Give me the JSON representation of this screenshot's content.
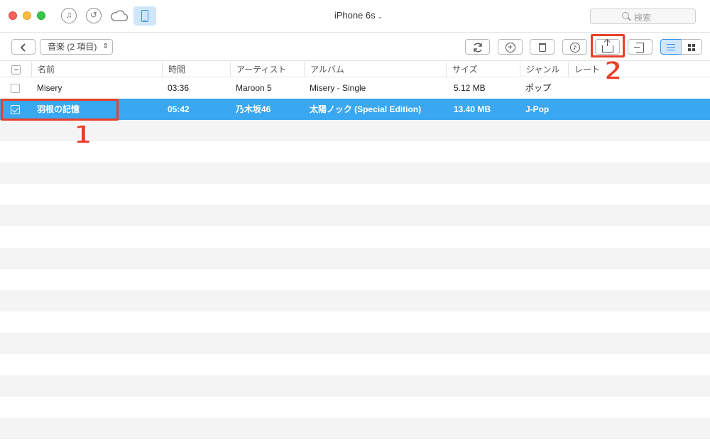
{
  "window": {
    "device_name": "iPhone 6s",
    "search_placeholder": "検索"
  },
  "toolbar": {
    "back_label": "<",
    "category_label": "音楽 (2 項目)"
  },
  "table": {
    "columns": {
      "name": "名前",
      "time": "時間",
      "artist": "アーティスト",
      "album": "アルバム",
      "size": "サイズ",
      "genre": "ジャンル",
      "rate": "レート"
    },
    "rows": [
      {
        "name": "Misery",
        "time": "03:36",
        "artist": "Maroon 5",
        "album": "Misery - Single",
        "size": "5.12 MB",
        "genre": "ポップ",
        "selected": false
      },
      {
        "name": "羽根の記憶",
        "time": "05:42",
        "artist": "乃木坂46",
        "album": "太陽ノック (Special Edition)",
        "size": "13.40 MB",
        "genre": "J-Pop",
        "selected": true
      }
    ]
  },
  "annotations": {
    "step1": "1",
    "step2": "2",
    "color": "#e8402a"
  },
  "colors": {
    "selection": "#3aa8f0",
    "accent": "#3d8ee6"
  },
  "icons": [
    "music-icon",
    "restore-icon",
    "cloud-icon",
    "phone-icon",
    "search-icon",
    "refresh-icon",
    "add-icon",
    "trash-icon",
    "itunes-icon",
    "export-to-pc-icon",
    "import-icon",
    "list-view-icon",
    "grid-view-icon"
  ]
}
